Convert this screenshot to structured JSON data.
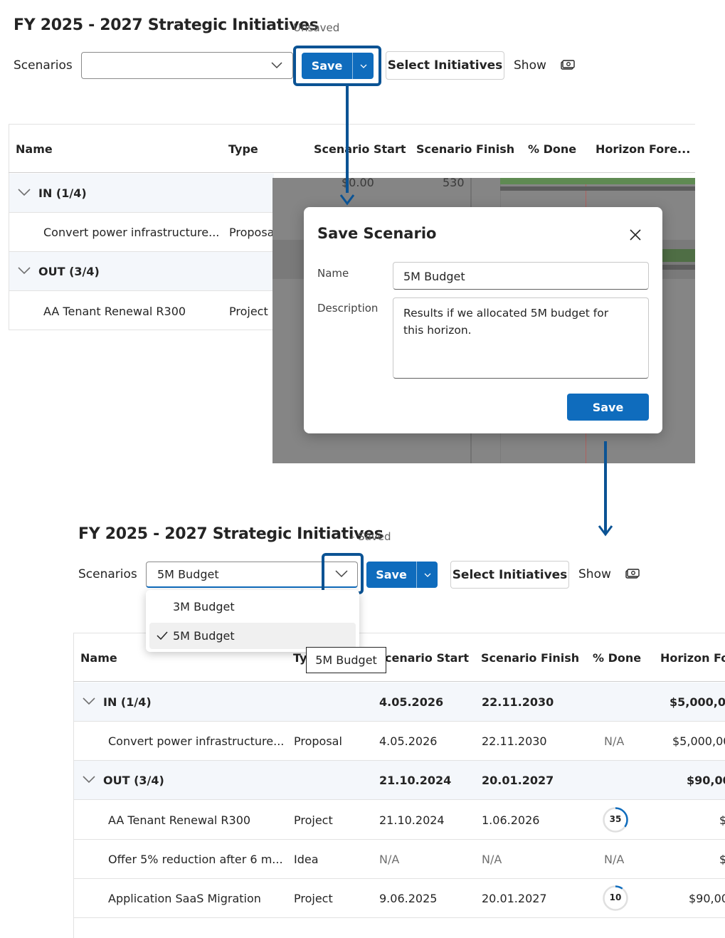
{
  "before": {
    "title": "FY 2025 - 2027 Strategic Initiatives",
    "status": "- Unsaved",
    "scenarios_label": "Scenarios",
    "scenario_value": "",
    "save_label": "Save",
    "select_initiatives_label": "Select Initiatives",
    "show_label": "Show",
    "columns": [
      "Name",
      "Type",
      "Scenario Start",
      "Scenario Finish",
      "% Done",
      "Horizon Fore..."
    ],
    "groups": [
      {
        "label": "IN (1/4)",
        "rows": [
          {
            "name": "Convert power infrastructure...",
            "type": "Proposal"
          }
        ]
      },
      {
        "label": "OUT (3/4)",
        "rows": [
          {
            "name": "AA Tenant Renewal R300",
            "type": "Project"
          }
        ]
      }
    ],
    "background_values": {
      "start": "$0.00",
      "finish": "530"
    }
  },
  "modal": {
    "title": "Save Scenario",
    "name_label": "Name",
    "name_value": "5M Budget",
    "description_label": "Description",
    "description_value": "Results if we allocated 5M budget for this horizon.",
    "save_label": "Save"
  },
  "after": {
    "title": "FY 2025 - 2027 Strategic Initiatives",
    "status": "- Saved",
    "scenarios_label": "Scenarios",
    "scenario_value": "5M Budget",
    "save_label": "Save",
    "select_initiatives_label": "Select Initiatives",
    "show_label": "Show",
    "dropdown_options": [
      {
        "label": "3M Budget",
        "selected": false
      },
      {
        "label": "5M Budget",
        "selected": true
      }
    ],
    "tooltip": "5M Budget",
    "columns": [
      "Name",
      "Ty",
      "cenario Start",
      "Scenario Finish",
      "% Done",
      "Horizon Fo"
    ],
    "groups": [
      {
        "label": "IN (1/4)",
        "start": "4.05.2026",
        "finish": "22.11.2030",
        "horizon": "$5,000,00",
        "rows": [
          {
            "name": "Convert power infrastructure...",
            "type": "Proposal",
            "start": "4.05.2026",
            "finish": "22.11.2030",
            "done": "N/A",
            "horizon": "$5,000,00"
          }
        ]
      },
      {
        "label": "OUT (3/4)",
        "start": "21.10.2024",
        "finish": "20.01.2027",
        "horizon": "$90,00",
        "rows": [
          {
            "name": "AA Tenant Renewal R300",
            "type": "Project",
            "start": "21.10.2024",
            "finish": "1.06.2026",
            "done": "35",
            "horizon": "$"
          },
          {
            "name": "Offer 5% reduction after 6 m...",
            "type": "Idea",
            "start": "N/A",
            "finish": "N/A",
            "done": "N/A",
            "horizon": "$"
          },
          {
            "name": "Application SaaS Migration",
            "type": "Project",
            "start": "9.06.2025",
            "finish": "20.01.2027",
            "done": "10",
            "horizon": "$90,00"
          }
        ]
      }
    ]
  },
  "colors": {
    "accent": "#0f6cbd",
    "highlight": "#0b5394",
    "progress": "#0f6cbd",
    "gantt_green": "#5f9e4f"
  }
}
